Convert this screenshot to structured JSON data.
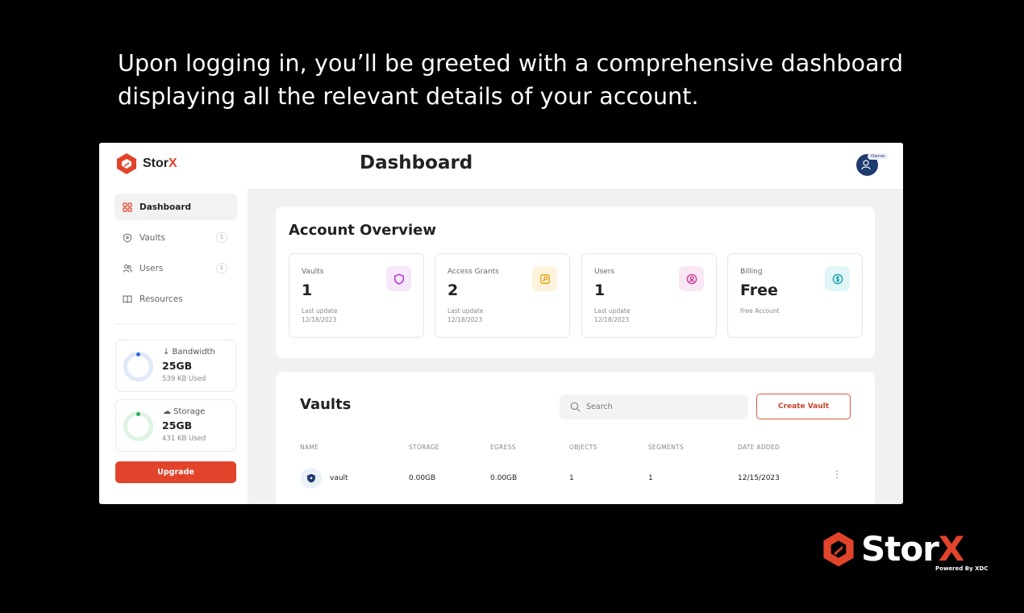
{
  "caption": "Upon logging in, you’ll be greeted with a comprehensive dashboard displaying all the relevant details of your account.",
  "brand": {
    "name": "Stor",
    "name_x": "X",
    "accent": "#e2442b"
  },
  "sidebar": {
    "items": [
      {
        "label": "Dashboard",
        "icon": "grid-icon",
        "count": ""
      },
      {
        "label": "Vaults",
        "icon": "shield-icon",
        "count": "1"
      },
      {
        "label": "Users",
        "icon": "users-icon",
        "count": "1"
      },
      {
        "label": "Resources",
        "icon": "book-icon",
        "count": ""
      }
    ],
    "bandwidth": {
      "label": "↓ Bandwidth",
      "value": "25GB",
      "used": "539 KB Used",
      "color": "#2f6fd6"
    },
    "storage": {
      "label": "☁ Storage",
      "value": "25GB",
      "used": "431 KB Used",
      "color": "#2bb35a"
    },
    "upgrade_label": "Upgrade"
  },
  "header": {
    "title": "Dashboard",
    "role_badge": "Owner"
  },
  "overview": {
    "title": "Account Overview",
    "cards": [
      {
        "label": "Vaults",
        "value": "1",
        "meta1": "Last update",
        "meta2": "12/18/2023",
        "icon": "shield-icon",
        "icon_bg": "#f6e8fb",
        "icon_color": "#b43bd6"
      },
      {
        "label": "Access Grants",
        "value": "2",
        "meta1": "Last update",
        "meta2": "12/18/2023",
        "icon": "key-icon",
        "icon_bg": "#fdf3dc",
        "icon_color": "#e0a21a"
      },
      {
        "label": "Users",
        "value": "1",
        "meta1": "Last update",
        "meta2": "12/18/2023",
        "icon": "user-icon",
        "icon_bg": "#fbe6f3",
        "icon_color": "#c73c95"
      },
      {
        "label": "Billing",
        "value": "Free",
        "meta1": "Free Account",
        "meta2": "",
        "icon": "dollar-icon",
        "icon_bg": "#e0f6f7",
        "icon_color": "#1aa3ad"
      }
    ]
  },
  "vaults": {
    "title": "Vaults",
    "search_placeholder": "Search",
    "create_label": "Create Vault",
    "columns": [
      "NAME",
      "STORAGE",
      "EGRESS",
      "OBJECTS",
      "SEGMENTS",
      "DATE ADDED"
    ],
    "rows": [
      {
        "name": "vault",
        "storage": "0.00GB",
        "egress": "0.00GB",
        "objects": "1",
        "segments": "1",
        "date": "12/15/2023"
      }
    ]
  },
  "footer_logo": {
    "name": "Stor",
    "name_x": "X",
    "tagline": "Powered By XDC"
  }
}
